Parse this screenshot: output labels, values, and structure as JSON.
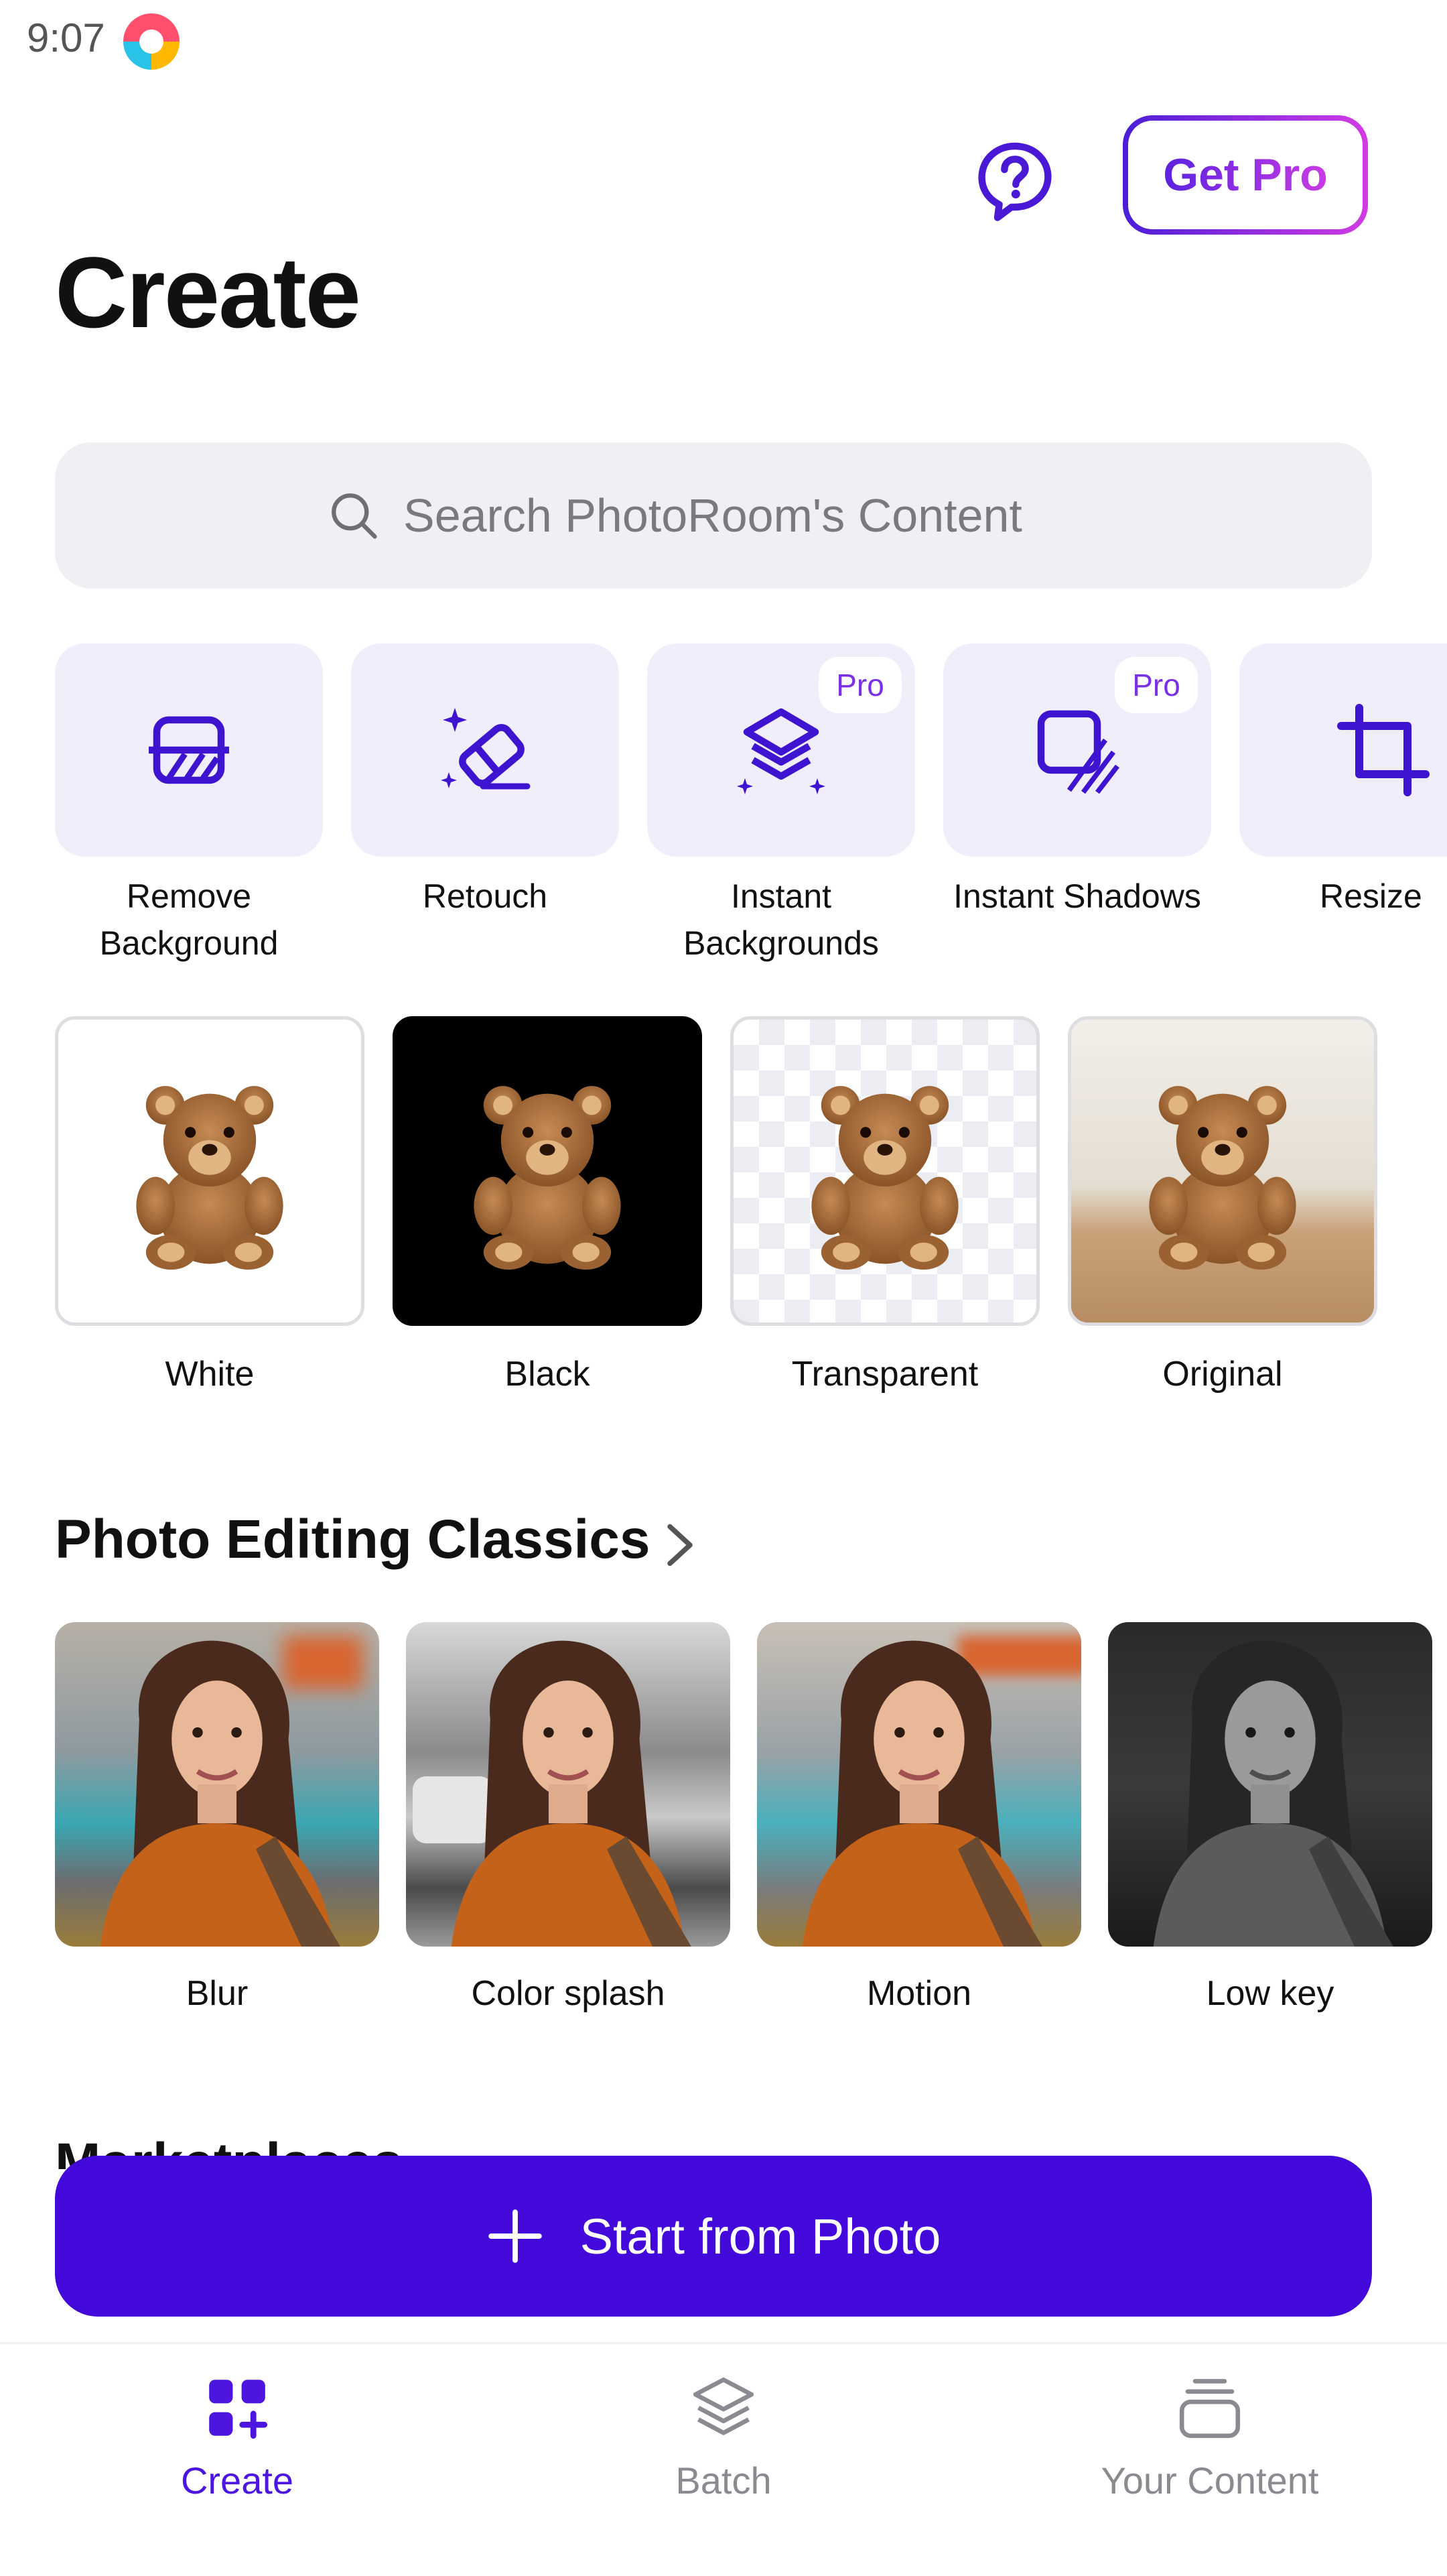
{
  "status_bar": {
    "time": "9:07"
  },
  "header": {
    "get_pro_label": "Get Pro",
    "title": "Create"
  },
  "search": {
    "placeholder": "Search PhotoRoom's Content"
  },
  "tools": [
    {
      "label": "Remove Background",
      "icon": "remove-background-icon",
      "pro": false
    },
    {
      "label": "Retouch",
      "icon": "eraser-sparkle-icon",
      "pro": false
    },
    {
      "label": "Instant Backgrounds",
      "icon": "layers-sparkle-icon",
      "pro": true,
      "badge": "Pro"
    },
    {
      "label": "Instant Shadows",
      "icon": "shadow-square-icon",
      "pro": true,
      "badge": "Pro"
    },
    {
      "label": "Resize",
      "icon": "crop-icon",
      "pro": false
    }
  ],
  "background_options": [
    {
      "label": "White"
    },
    {
      "label": "Black"
    },
    {
      "label": "Transparent"
    },
    {
      "label": "Original"
    }
  ],
  "photo_editing_classics": {
    "title": "Photo Editing Classics",
    "items": [
      {
        "label": "Blur"
      },
      {
        "label": "Color splash"
      },
      {
        "label": "Motion"
      },
      {
        "label": "Low key"
      }
    ]
  },
  "marketplaces": {
    "title": "Marketplaces"
  },
  "start_button": {
    "label": "Start from Photo"
  },
  "bottom_nav": [
    {
      "label": "Create",
      "active": true
    },
    {
      "label": "Batch",
      "active": false
    },
    {
      "label": "Your Content",
      "active": false
    }
  ],
  "colors": {
    "accent": "#4309db",
    "card": "#f1eefc",
    "pro_text": "#7b2fe6"
  }
}
